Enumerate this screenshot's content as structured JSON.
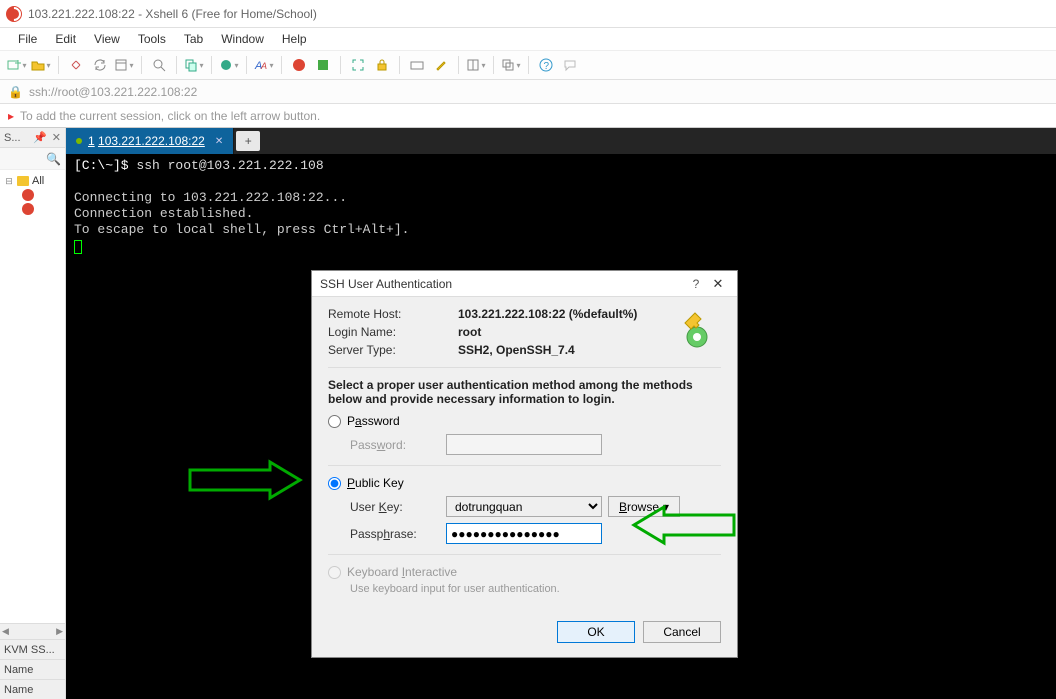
{
  "window": {
    "title": "103.221.222.108:22 - Xshell 6 (Free for Home/School)"
  },
  "menu": {
    "file": "File",
    "edit": "Edit",
    "view": "View",
    "tools": "Tools",
    "tab": "Tab",
    "window": "Window",
    "help": "Help"
  },
  "addressbar": {
    "text": "ssh://root@103.221.222.108:22"
  },
  "hint": {
    "text": "To add the current session, click on the left arrow button."
  },
  "leftpane": {
    "header": "S...",
    "tree_root": "All",
    "bottom1": "KVM SS...",
    "bottom2": "Name",
    "bottom3": "Name"
  },
  "tab": {
    "number": "1",
    "label": "103.221.222.108:22"
  },
  "terminal": {
    "line1_prompt": "[C:\\~]$",
    "line1_cmd": " ssh root@103.221.222.108",
    "line3": "Connecting to 103.221.222.108:22...",
    "line4": "Connection established.",
    "line5": "To escape to local shell, press Ctrl+Alt+]."
  },
  "dialog": {
    "title": "SSH User Authentication",
    "remote_host_lbl": "Remote Host:",
    "remote_host_val": "103.221.222.108:22 (%default%)",
    "login_name_lbl": "Login Name:",
    "login_name_val": "root",
    "server_type_lbl": "Server Type:",
    "server_type_val": "SSH2, OpenSSH_7.4",
    "instruction": "Select a proper user authentication method among the methods below and provide necessary information to login.",
    "radio_password": "Password",
    "password_lbl": "Password:",
    "radio_publickey": "Public Key",
    "userkey_lbl": "User Key:",
    "userkey_val": "dotrungquan",
    "browse": "Browse",
    "passphrase_lbl": "Passphrase:",
    "passphrase_val": "●●●●●●●●●●●●●●●",
    "radio_kbd": "Keyboard Interactive",
    "kbd_note": "Use keyboard input for user authentication.",
    "ok": "OK",
    "cancel": "Cancel"
  }
}
